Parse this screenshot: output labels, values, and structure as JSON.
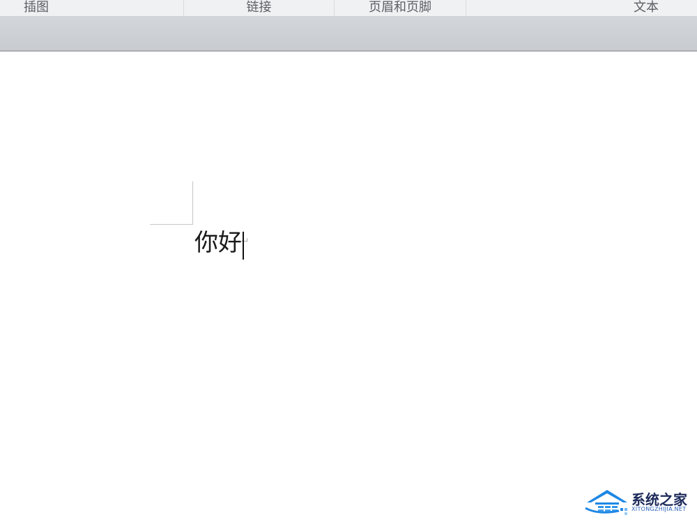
{
  "ribbon": {
    "groups": [
      {
        "label": "插图"
      },
      {
        "label": "链接"
      },
      {
        "label": "页眉和页脚"
      },
      {
        "label": "文本"
      }
    ]
  },
  "document": {
    "text": "你好",
    "paragraph_mark": "↵"
  },
  "watermark": {
    "brand": "系统之家",
    "url": "XITONGZHIJIA.NET",
    "icon": "house-icon",
    "color": "#1e88e5"
  }
}
